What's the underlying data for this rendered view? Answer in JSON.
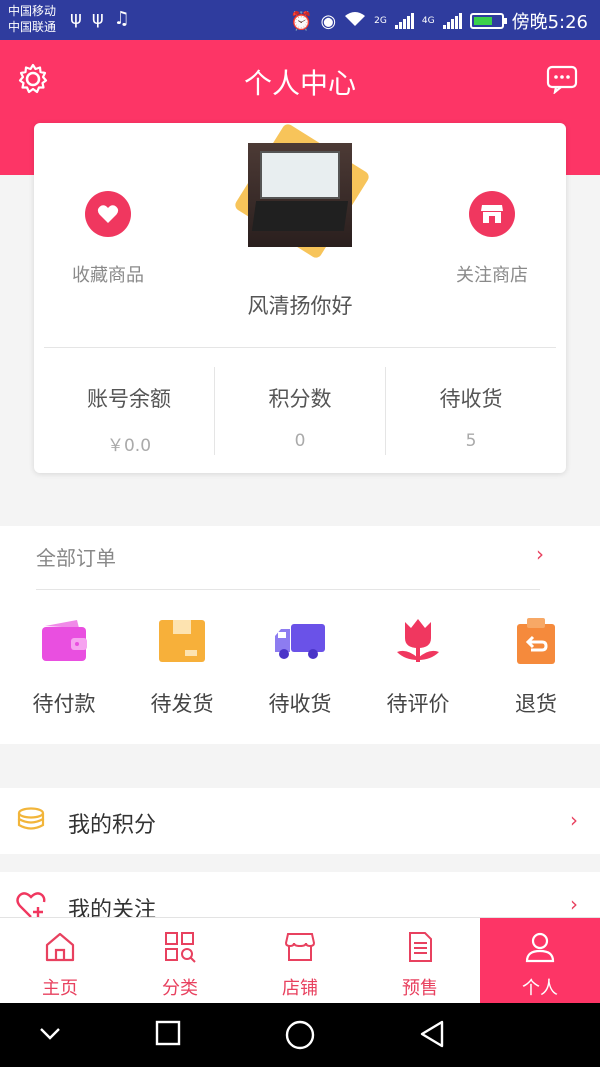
{
  "status_bar": {
    "carrier_1": "中国移动",
    "carrier_2": "中国联通",
    "network_1": "2G",
    "network_2": "4G",
    "time": "傍晚5:26"
  },
  "header": {
    "title": "个人中心",
    "left_icon": "gear-icon",
    "right_icon": "message-icon"
  },
  "profile": {
    "favorites_label": "收藏商品",
    "follow_shop_label": "关注商店",
    "greeting": "风清扬你好",
    "stats": [
      {
        "label": "账号余额",
        "value": "￥0.0"
      },
      {
        "label": "积分数",
        "value": "0"
      },
      {
        "label": "待收货",
        "value": "5"
      }
    ]
  },
  "orders": {
    "title": "全部订单",
    "items": [
      {
        "label": "待付款",
        "icon": "wallet-icon"
      },
      {
        "label": "待发货",
        "icon": "box-icon"
      },
      {
        "label": "待收货",
        "icon": "truck-icon"
      },
      {
        "label": "待评价",
        "icon": "flower-icon"
      },
      {
        "label": "退货",
        "icon": "return-bag-icon"
      }
    ]
  },
  "menu": {
    "points_label": "我的积分",
    "follows_label": "我的关注"
  },
  "bottom_nav": {
    "items": [
      {
        "label": "主页",
        "icon": "home-icon"
      },
      {
        "label": "分类",
        "icon": "category-icon"
      },
      {
        "label": "店铺",
        "icon": "store-icon"
      },
      {
        "label": "预售",
        "icon": "presale-doc-icon"
      },
      {
        "label": "个人",
        "icon": "person-icon"
      }
    ]
  },
  "colors": {
    "brand": "#fd3566",
    "status_bar": "#2f3c9e",
    "accent_red": "#f0375f",
    "wallet": "#e94fe0",
    "box": "#f7b03a",
    "truck": "#6a52e8",
    "flower": "#f0375f",
    "return_bag": "#f58a3c",
    "coins": "#f2b53a"
  }
}
